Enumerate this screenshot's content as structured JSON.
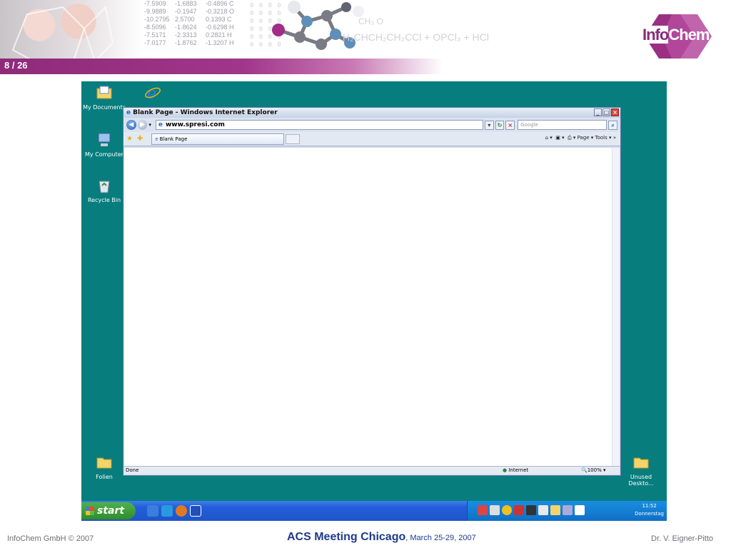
{
  "slide": {
    "page_number": "8 / 26"
  },
  "banner": {
    "numbers": [
      [
        "-7.5909",
        "-9.9889",
        "-10.2795",
        "-8.5096",
        "-7.5171",
        "-7.0177"
      ],
      [
        "-1.6883",
        "-0.1947",
        "2.5700",
        "-1.8624",
        "-2.3313",
        "-1.8762"
      ],
      [
        "-0.4896 C",
        "-0.3218 O",
        "0.1393 C",
        "-0.6298 H",
        "0.2821 H",
        "-1.3207 H"
      ]
    ],
    "formula_top": "CH₃          O",
    "formula": "H₂CHCH₂CH₂CCl + OPCl₃ + HCl",
    "logo_info": "Info",
    "logo_chem": "Chem"
  },
  "desktop": {
    "icons": {
      "my_documents": "My Documents",
      "my_computer": "My Computer",
      "recycle_bin": "Recycle Bin",
      "folien": "Folien",
      "unused_desktop": "Unused Deskto..."
    }
  },
  "browser": {
    "title": "Blank Page - Windows Internet Explorer",
    "address": "www.spresi.com",
    "search_placeholder": "Google",
    "tab_label": "Blank Page",
    "toolbar_right": "Page ▾  Tools ▾",
    "status_text": "Done",
    "status_zone": "Internet",
    "zoom": "100%"
  },
  "taskbar": {
    "start_label": "start",
    "time": "11:52",
    "day": "Donnerstag"
  },
  "footer": {
    "left": "InfoChem GmbH © 2007",
    "center_title": "ACS Meeting Chicago",
    "center_date": ", March 25-29, 2007",
    "right": "Dr. V. Eigner-Pitto"
  },
  "colors": {
    "brand_purple": "#8f2a79",
    "desktop_teal": "#087d7d",
    "taskbar_blue": "#245edb"
  }
}
